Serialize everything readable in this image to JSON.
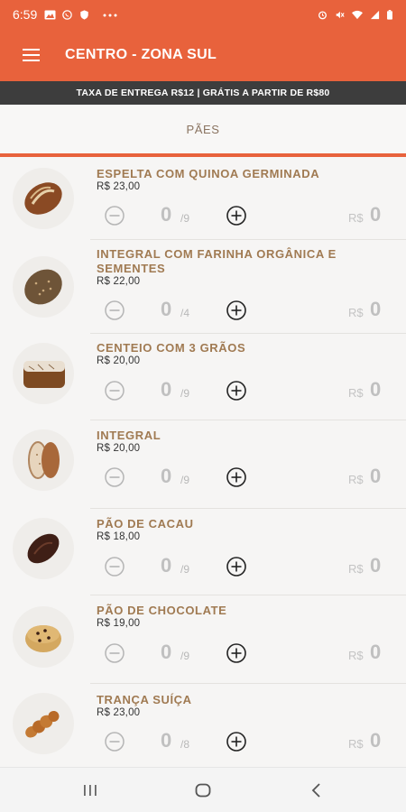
{
  "status_bar": {
    "time": "6:59",
    "left_icons": [
      "image-icon",
      "whatsapp-icon",
      "shield-icon",
      "more-dots-icon"
    ],
    "right_icons": [
      "alarm-icon",
      "mute-icon",
      "wifi-icon",
      "signal-icon",
      "battery-icon"
    ]
  },
  "app_bar": {
    "title": "CENTRO - ZONA SUL",
    "menu_icon": "hamburger-menu-icon"
  },
  "banner": {
    "text": "TAXA DE ENTREGA R$12 | GRÁTIS A PARTIR DE R$80"
  },
  "category": {
    "title": "PÃES"
  },
  "colors": {
    "accent": "#e8623c",
    "banner_bg": "#3d3d3d",
    "product_name": "#a07a52"
  },
  "products": [
    {
      "name": "ESPELTA COM QUINOA GERMINADA",
      "price": "R$ 23,00",
      "qty": "0",
      "max": "/9",
      "currency": "R$",
      "total": "0"
    },
    {
      "name": "INTEGRAL COM FARINHA ORGÂNICA E SEMENTES",
      "price": "R$ 22,00",
      "qty": "0",
      "max": "/4",
      "currency": "R$",
      "total": "0"
    },
    {
      "name": "CENTEIO COM 3 GRÃOS",
      "price": "R$ 20,00",
      "qty": "0",
      "max": "/9",
      "currency": "R$",
      "total": "0"
    },
    {
      "name": "INTEGRAL",
      "price": "R$ 20,00",
      "qty": "0",
      "max": "/9",
      "currency": "R$",
      "total": "0"
    },
    {
      "name": "PÃO DE CACAU",
      "price": "R$ 18,00",
      "qty": "0",
      "max": "/9",
      "currency": "R$",
      "total": "0"
    },
    {
      "name": "PÃO DE CHOCOLATE",
      "price": "R$ 19,00",
      "qty": "0",
      "max": "/9",
      "currency": "R$",
      "total": "0"
    },
    {
      "name": "TRANÇA SUÍÇA",
      "price": "R$ 23,00",
      "qty": "0",
      "max": "/8",
      "currency": "R$",
      "total": "0"
    }
  ],
  "nav": {
    "icons": [
      "recent-apps-icon",
      "home-icon",
      "back-icon"
    ]
  }
}
